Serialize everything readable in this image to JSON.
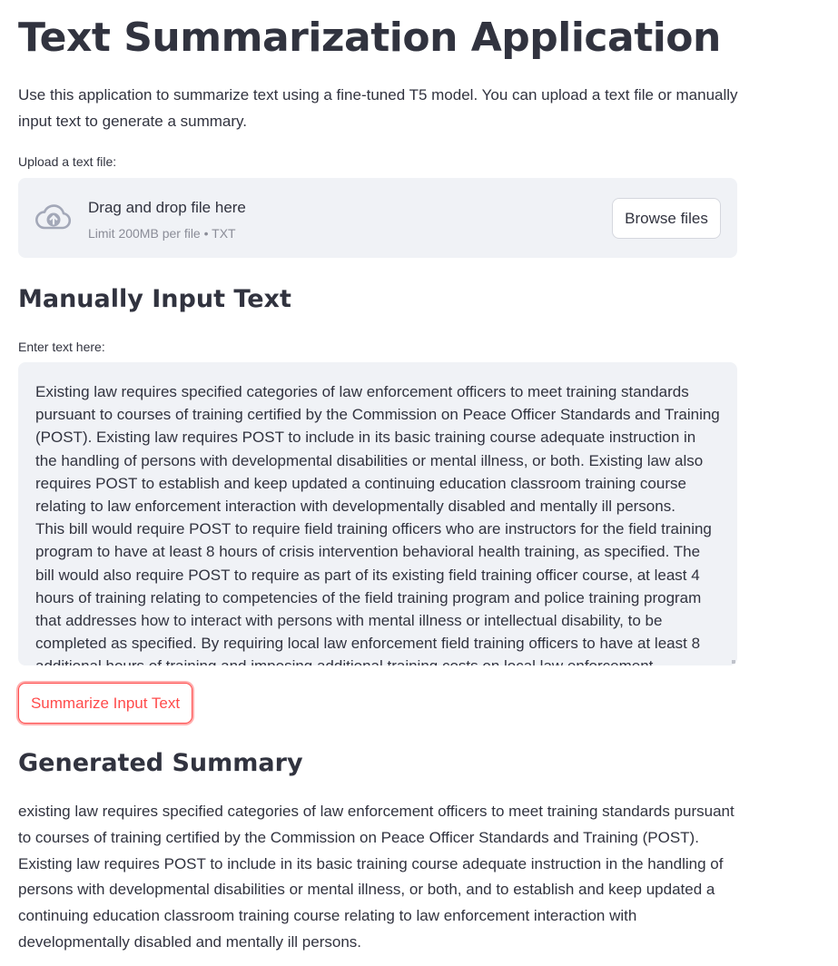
{
  "header": {
    "title": "Text Summarization Application",
    "description": "Use this application to summarize text using a fine-tuned T5 model. You can upload a text file or manually input text to generate a summary."
  },
  "uploader": {
    "label": "Upload a text file:",
    "drop_title": "Drag and drop file here",
    "drop_limit": "Limit 200MB per file • TXT",
    "browse_label": "Browse files",
    "icon": "cloud-upload-icon"
  },
  "manual_input": {
    "heading": "Manually Input Text",
    "label": "Enter text here:",
    "value": "Existing law requires specified categories of law enforcement officers to meet training standards pursuant to courses of training certified by the Commission on Peace Officer Standards and Training (POST). Existing law requires POST to include in its basic training course adequate instruction in the handling of persons with developmental disabilities or mental illness, or both. Existing law also requires POST to establish and keep updated a continuing education classroom training course relating to law enforcement interaction with developmentally disabled and mentally ill persons.\nThis bill would require POST to require field training officers who are instructors for the field training program to have at least 8 hours of crisis intervention behavioral health training, as specified. The bill would also require POST to require as part of its existing field training officer course, at least 4 hours of training relating to competencies of the field training program and police training program that addresses how to interact with persons with mental illness or intellectual disability, to be completed as specified. By requiring local law enforcement field training officers to have at least 8 additional hours of training and imposing additional training costs on local law enforcement"
  },
  "actions": {
    "summarize_label": "Summarize Input Text"
  },
  "summary": {
    "heading": "Generated Summary",
    "text": "existing law requires specified categories of law enforcement officers to meet training standards pursuant to courses of training certified by the Commission on Peace Officer Standards and Training (POST). Existing law requires POST to include in its basic training course adequate instruction in the handling of persons with developmental disabilities or mental illness, or both, and to establish and keep updated a continuing education classroom training course relating to law enforcement interaction with developmentally disabled and mentally ill persons."
  },
  "colors": {
    "primary": "#ff4b4b",
    "text": "#31333f",
    "widget_bg": "#f0f2f6",
    "muted": "#8b8d98"
  }
}
